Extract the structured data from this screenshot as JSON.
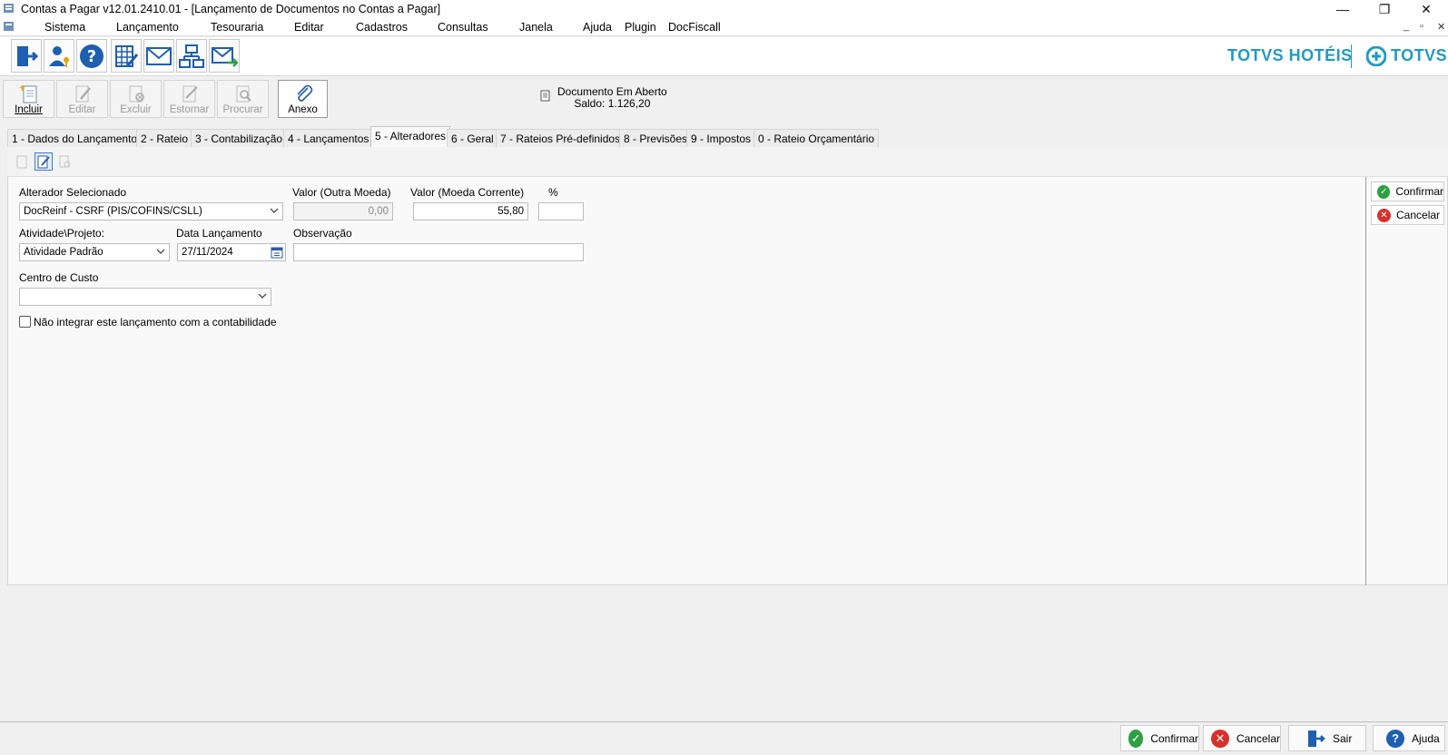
{
  "window": {
    "title": "Contas a Pagar v12.01.2410.01 - [Lançamento de Documentos no Contas a Pagar]",
    "minimize": "—",
    "maximize": "❐",
    "close": "✕"
  },
  "menu": {
    "items": [
      "Sistema",
      "Lançamento",
      "Tesouraria",
      "Editar",
      "Cadastros",
      "Consultas",
      "Janela",
      "Ajuda",
      "Plugin",
      "DocFiscall"
    ],
    "mdi_min": "_",
    "mdi_restore": "▫",
    "mdi_close": "✕"
  },
  "brand": {
    "name1": "TOTVS HOTÉIS",
    "name2": "TOTVS",
    "color": "#1f9bc4"
  },
  "actions": {
    "incluir": "Incluir",
    "editar": "Editar",
    "excluir": "Excluir",
    "estornar": "Estornar",
    "procurar": "Procurar",
    "anexo": "Anexo"
  },
  "document_status": {
    "line1": "Documento Em Aberto",
    "line2": "Saldo: 1.126,20"
  },
  "tabs": [
    "1 - Dados do Lançamento",
    "2 - Rateio",
    "3 - Contabilização",
    "4 - Lançamentos",
    "5 - Alteradores",
    "6 - Geral",
    "7 - Rateios Pré-definidos",
    "8 - Previsões",
    "9 - Impostos",
    "0 - Rateio Orçamentário"
  ],
  "active_tab": "5 - Alteradores",
  "form": {
    "alterador_label": "Alterador Selecionado",
    "alterador_value": "DocReinf - CSRF (PIS/COFINS/CSLL)",
    "valor_outra_label": "Valor (Outra Moeda)",
    "valor_outra_value": "0,00",
    "valor_corrente_label": "Valor (Moeda Corrente)",
    "valor_corrente_value": "55,80",
    "percent_label": "%",
    "percent_value": "",
    "atividade_label": "Atividade\\Projeto:",
    "atividade_value": "Atividade Padrão",
    "data_label": "Data Lançamento",
    "data_value": "27/11/2024",
    "observacao_label": "Observação",
    "observacao_value": "",
    "centro_label": "Centro de Custo",
    "centro_value": "",
    "nao_integrar_label": "Não integrar este lançamento com a contabilidade",
    "nao_integrar_checked": false
  },
  "side_buttons": {
    "confirmar": "Confirmar",
    "cancelar": "Cancelar"
  },
  "bottom_buttons": {
    "confirmar": "Confirmar",
    "cancelar": "Cancelar",
    "sair": "Sair",
    "ajuda": "Ajuda"
  }
}
